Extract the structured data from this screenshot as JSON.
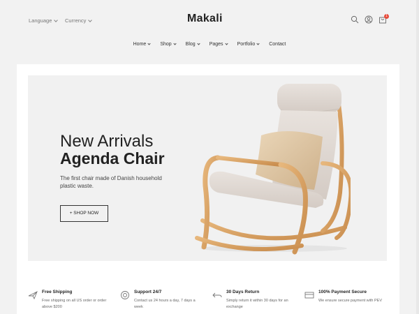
{
  "header": {
    "language_label": "Language",
    "currency_label": "Currency",
    "logo_text": "Makali",
    "cart_count": "1",
    "icons": [
      "search-icon",
      "user-icon",
      "cart-icon"
    ]
  },
  "nav": {
    "items": [
      {
        "label": "Home",
        "has_dropdown": true
      },
      {
        "label": "Shop",
        "has_dropdown": true
      },
      {
        "label": "Blog",
        "has_dropdown": true
      },
      {
        "label": "Pages",
        "has_dropdown": true
      },
      {
        "label": "Portfolio",
        "has_dropdown": true
      },
      {
        "label": "Contact",
        "has_dropdown": false
      }
    ]
  },
  "hero": {
    "subtitle": "New Arrivals",
    "title": "Agenda Chair",
    "description": "The first chair made of Danish household plastic waste.",
    "button_label": "+ SHOP NOW"
  },
  "features": [
    {
      "icon": "plane-icon",
      "title": "Free Shipping",
      "text": "Free shipping on all US order or order above $200"
    },
    {
      "icon": "support-icon",
      "title": "Support 24/7",
      "text": "Contact us 24 hours a day, 7 days a week"
    },
    {
      "icon": "return-icon",
      "title": "30 Days Return",
      "text": "Simply return it within 30 days for an exchange"
    },
    {
      "icon": "card-icon",
      "title": "100% Payment Secure",
      "text": "We ensure secure payment with PEV"
    }
  ],
  "colors": {
    "page_bg": "#f2f2f2",
    "hero_bg": "#f1f1f1",
    "badge": "#e74c3c",
    "text_dark": "#222222"
  }
}
